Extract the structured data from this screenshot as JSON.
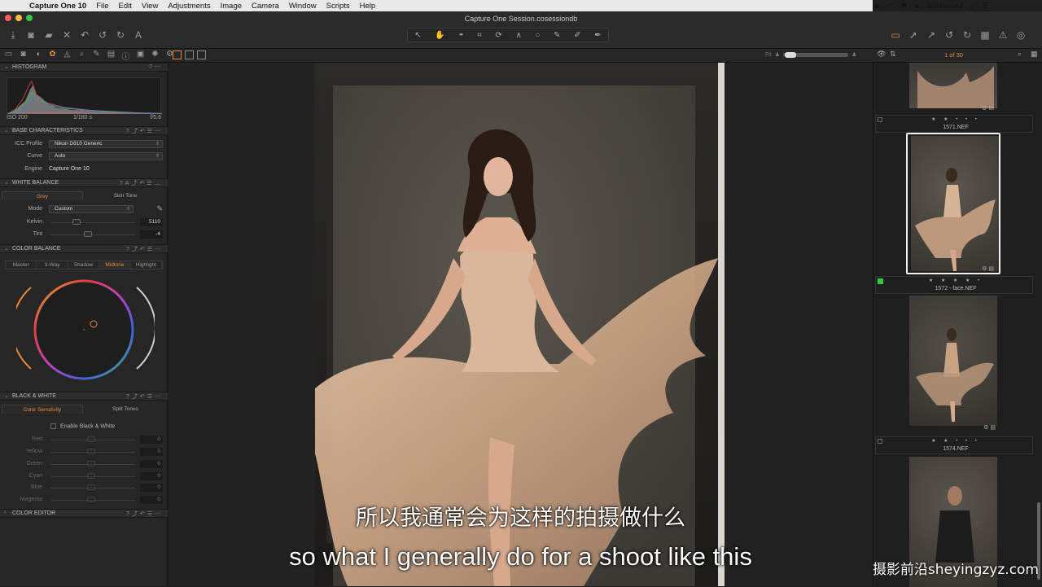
{
  "menubar": {
    "app_name": "Capture One 10",
    "menus": [
      "File",
      "Edit",
      "View",
      "Adjustments",
      "Image",
      "Camera",
      "Window",
      "Scripts",
      "Help"
    ],
    "user": "felixkunze2"
  },
  "window": {
    "title": "Capture One Session.cosessiondb"
  },
  "viewer": {
    "zoom_label": "Fit",
    "browser_count": "1 of 30"
  },
  "tools": {
    "histogram": {
      "title": "HISTOGRAM",
      "iso": "ISO 200",
      "shutter": "1/180 s",
      "aperture": "f/5.6"
    },
    "base_characteristics": {
      "title": "BASE CHARACTERISTICS",
      "icc_label": "ICC Profile",
      "icc_value": "Nikon D810 Generic",
      "curve_label": "Curve",
      "curve_value": "Auto",
      "engine_label": "Engine",
      "engine_value": "Capture One 10"
    },
    "white_balance": {
      "title": "WHITE BALANCE",
      "tabs": [
        "Grey",
        "Skin Tone"
      ],
      "mode_label": "Mode",
      "mode_value": "Custom",
      "kelvin_label": "Kelvin",
      "kelvin_value": "5110",
      "tint_label": "Tint",
      "tint_value": "-4"
    },
    "color_balance": {
      "title": "COLOR BALANCE",
      "tabs": [
        "Master",
        "3-Way",
        "Shadow",
        "Midtone",
        "Highlight"
      ]
    },
    "black_white": {
      "title": "BLACK & WHITE",
      "tabs": [
        "Color Sensitivity",
        "Split Tones"
      ],
      "enable_label": "Enable Black & White",
      "sliders": [
        {
          "label": "Red",
          "value": "0"
        },
        {
          "label": "Yellow",
          "value": "0"
        },
        {
          "label": "Green",
          "value": "0"
        },
        {
          "label": "Cyan",
          "value": "0"
        },
        {
          "label": "Blue",
          "value": "0"
        },
        {
          "label": "Magenta",
          "value": "0"
        }
      ]
    },
    "color_editor": {
      "title": "COLOR EDITOR"
    }
  },
  "browser": {
    "thumbnails": [
      {
        "name": "1571.NEF",
        "stars": "★ ★ • • •"
      },
      {
        "name": "1572 - face.NEF",
        "stars": "★ ★ ★ ★ •"
      },
      {
        "name": "1574.NEF",
        "stars": "★ ★ • • •"
      }
    ]
  },
  "subtitles": {
    "cn": "所以我通常会为这样的拍摄做什么",
    "en": "so what I generally do for a shoot like this"
  },
  "watermark": "摄影前沿sheyingzyz.com",
  "colors": {
    "accent": "#e8893a",
    "green_tag": "#2ecc40"
  }
}
